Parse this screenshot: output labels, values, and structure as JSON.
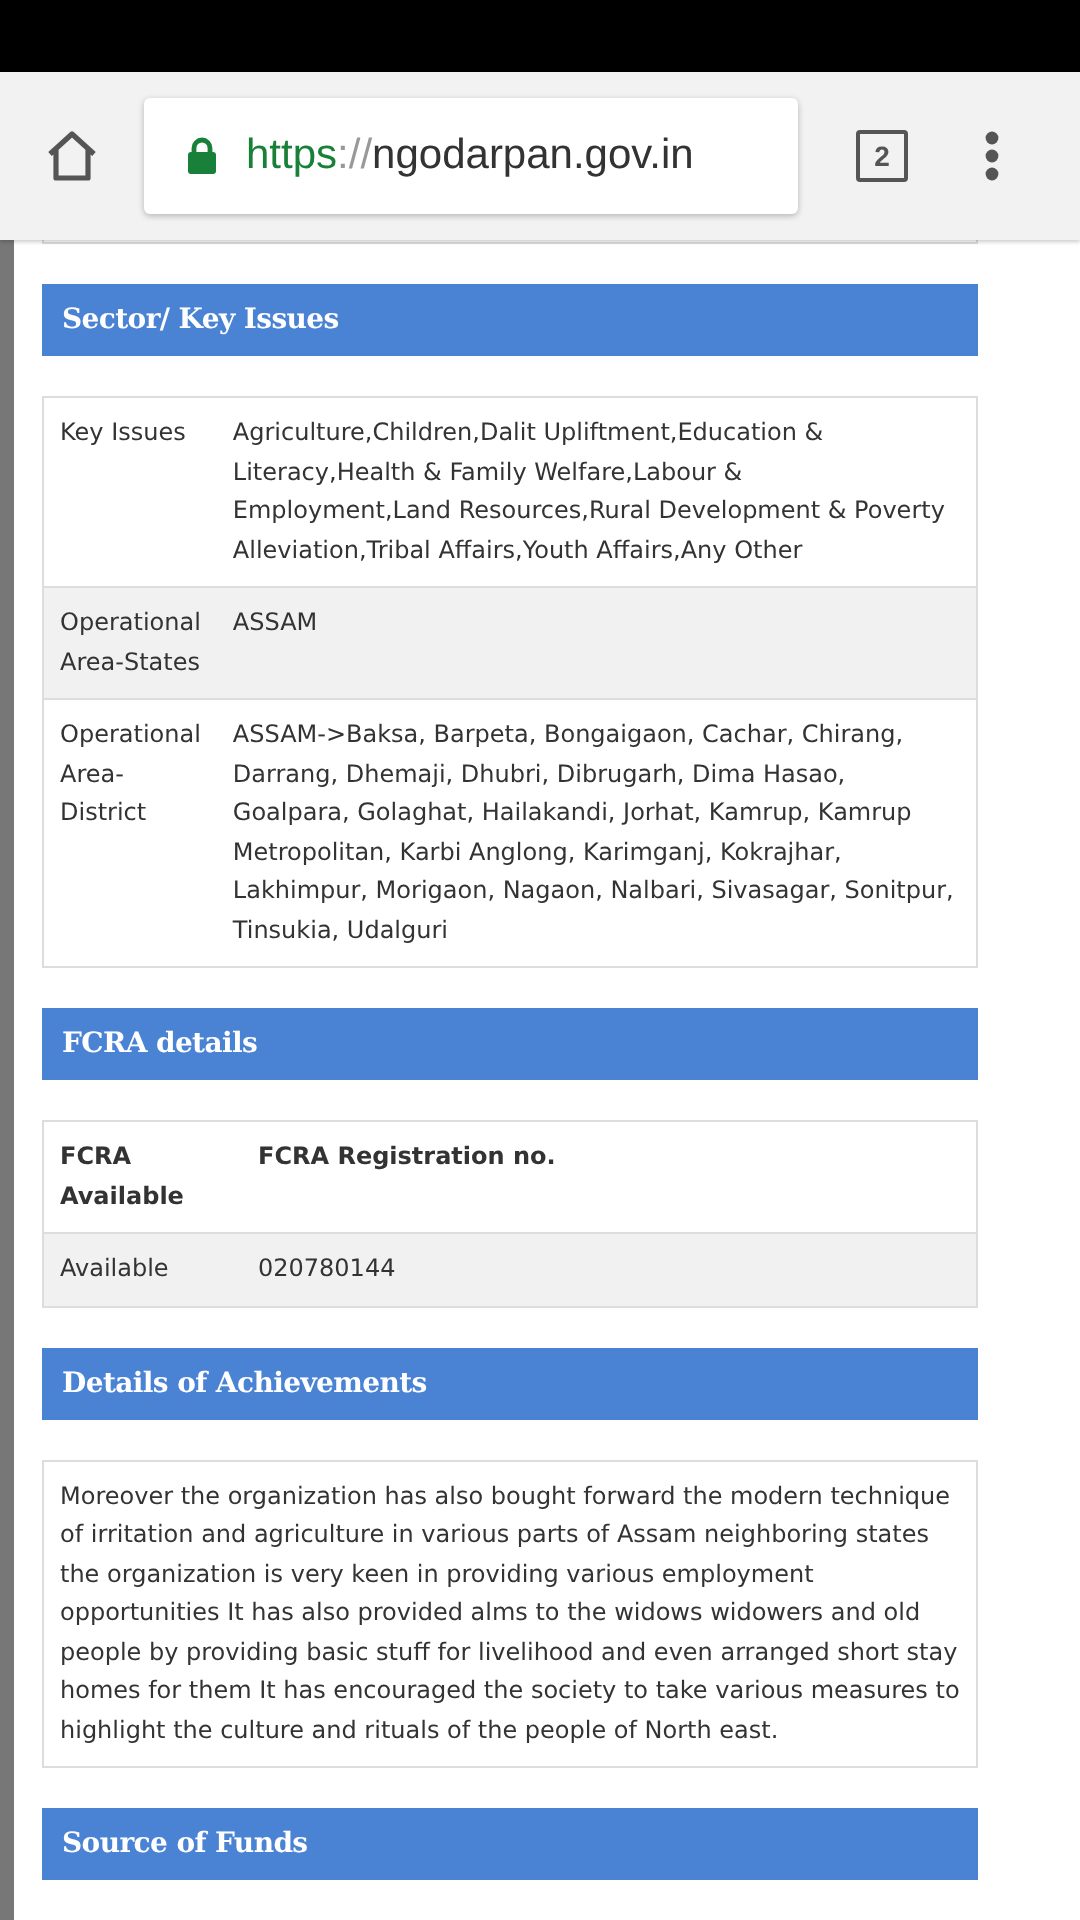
{
  "toolbar": {
    "url_scheme": "https",
    "url_separator": "://",
    "url_host": "ngodarpan.gov.in",
    "tab_count": "2"
  },
  "sections": [
    {
      "title": "Sector/ Key Issues",
      "kind": "table",
      "rows": [
        {
          "kind": "data",
          "cells": [
            "Key Issues",
            "Agriculture,Children,Dalit Upliftment,Education & Literacy,Health & Family Welfare,Labour & Employment,Land Resources,Rural Development & Poverty Alleviation,Tribal Affairs,Youth Affairs,Any Other"
          ]
        },
        {
          "kind": "data",
          "cells": [
            "Operational Area-States",
            "ASSAM"
          ]
        },
        {
          "kind": "data",
          "cells": [
            "Operational Area-District",
            "ASSAM->Baksa, Barpeta, Bongaigaon, Cachar, Chirang, Darrang, Dhemaji, Dhubri, Dibrugarh, Dima Hasao, Goalpara, Golaghat, Hailakandi, Jorhat, Kamrup, Kamrup Metropolitan, Karbi Anglong, Karimganj, Kokrajhar, Lakhimpur, Morigaon, Nagaon, Nalbari, Sivasagar, Sonitpur, Tinsukia, Udalguri"
          ]
        }
      ]
    },
    {
      "title": "FCRA details",
      "kind": "table",
      "rows": [
        {
          "kind": "header",
          "cells": [
            "FCRA Available",
            "FCRA Registration no."
          ]
        },
        {
          "kind": "data",
          "cells": [
            "Available",
            "020780144"
          ]
        }
      ]
    },
    {
      "title": "Details of Achievements",
      "kind": "text",
      "text": "Moreover the organization has also bought forward the modern technique of irritation and agriculture in various parts of Assam neighboring states the organization is very keen in providing various employment opportunities It has also provided alms to the widows widowers and old people by providing basic stuff for livelihood and even arranged short stay homes for them It has encouraged the society to take various measures to highlight the culture and rituals of the people of North east."
    },
    {
      "title": "Source of Funds",
      "kind": "heading"
    }
  ]
}
